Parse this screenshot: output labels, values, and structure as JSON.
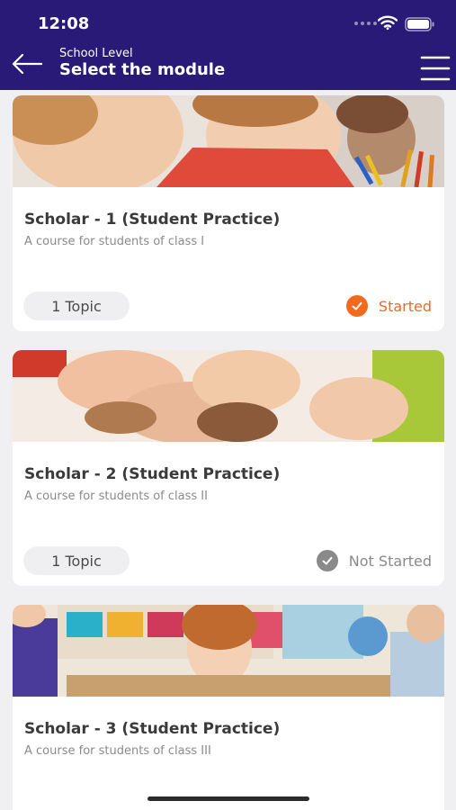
{
  "status_bar": {
    "time": "12:08"
  },
  "header": {
    "subtitle": "School Level",
    "title": "Select the module"
  },
  "colors": {
    "header_bg": "#2a1a78",
    "started": "#f26a1b",
    "not_started": "#8a8a8a"
  },
  "modules": [
    {
      "title": "Scholar - 1 (Student Practice)",
      "description": "A course for students of class I",
      "topics": "1 Topic",
      "status": "Started"
    },
    {
      "title": "Scholar - 2 (Student Practice)",
      "description": "A course for students of class II",
      "topics": "1 Topic",
      "status": "Not Started"
    },
    {
      "title": "Scholar - 3 (Student Practice)",
      "description": "A course for students of class III"
    }
  ]
}
